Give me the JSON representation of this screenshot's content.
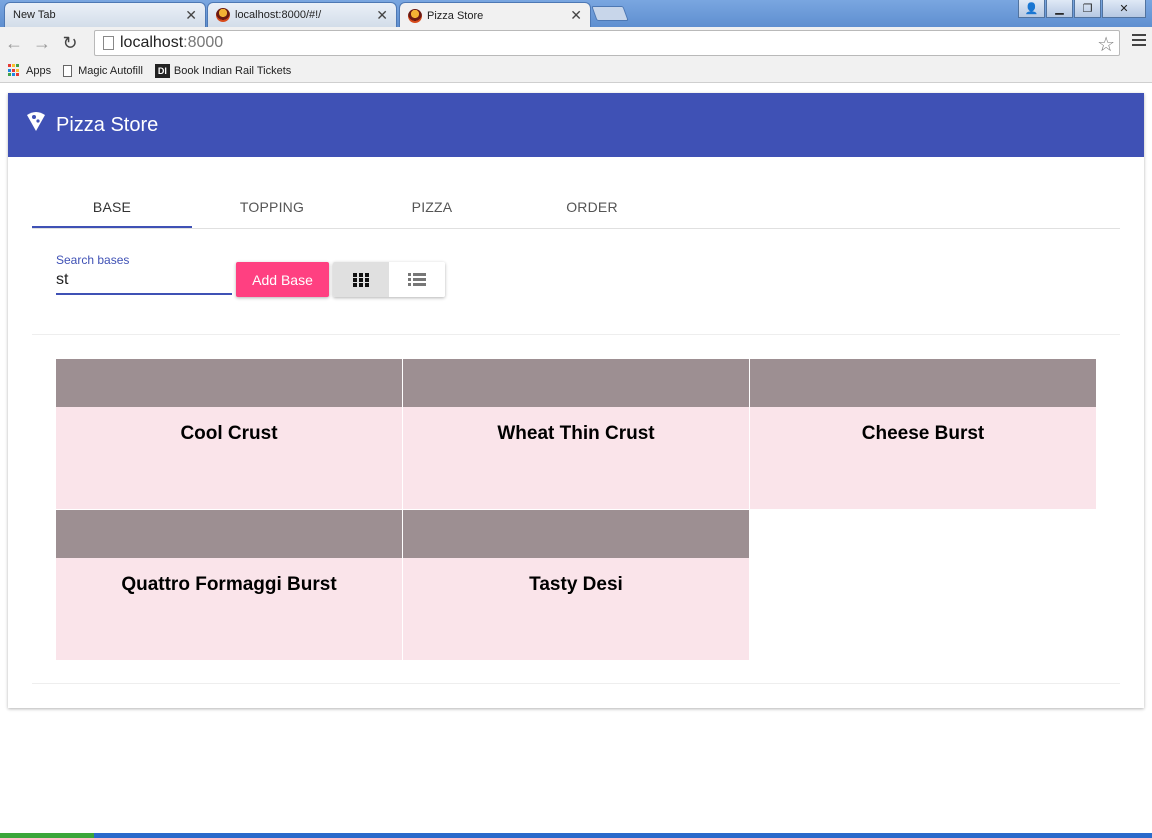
{
  "browser": {
    "tabs": [
      {
        "title": "New Tab",
        "active": false
      },
      {
        "title": "localhost:8000/#!/",
        "active": false
      },
      {
        "title": "Pizza Store",
        "active": true
      }
    ],
    "url_host": "localhost",
    "url_port": ":8000",
    "bookmarks": [
      "Apps",
      "Magic Autofill",
      "Book Indian Rail Tickets"
    ],
    "bookmark_di_icon": "DI"
  },
  "app": {
    "title": "Pizza Store",
    "brand_color": "#3f51b5",
    "accent_color": "#ff4081"
  },
  "tabs": [
    {
      "label": "BASE",
      "active": true
    },
    {
      "label": "TOPPING",
      "active": false
    },
    {
      "label": "PIZZA",
      "active": false
    },
    {
      "label": "ORDER",
      "active": false
    }
  ],
  "search": {
    "label": "Search bases",
    "value": "st"
  },
  "add_button": {
    "label": "Add Base"
  },
  "view_toggle": {
    "selected": "grid",
    "options": [
      "grid-view-icon",
      "list-view-icon"
    ]
  },
  "bases": [
    "Cool Crust",
    "Wheat Thin Crust",
    "Cheese Burst",
    "Quattro Formaggi Burst",
    "Tasty Desi"
  ]
}
